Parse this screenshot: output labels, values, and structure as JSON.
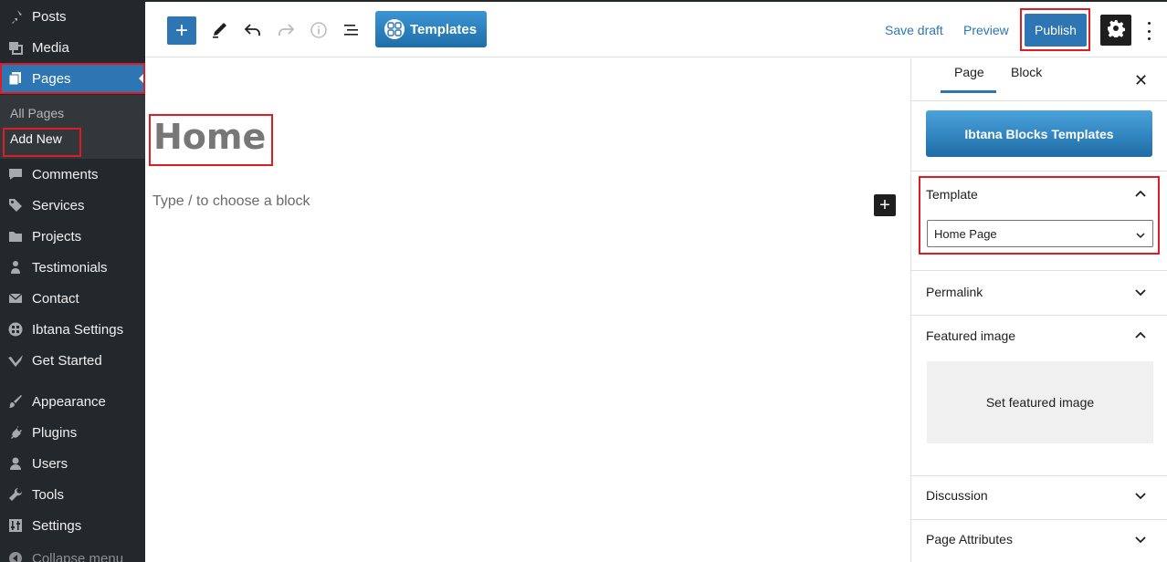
{
  "sidebar": {
    "items": [
      {
        "label": "Posts",
        "icon": "pin-icon"
      },
      {
        "label": "Media",
        "icon": "media-icon"
      },
      {
        "label": "Pages",
        "icon": "pages-icon"
      },
      {
        "label": "Comments",
        "icon": "comment-icon"
      },
      {
        "label": "Services",
        "icon": "tag-icon"
      },
      {
        "label": "Projects",
        "icon": "folder-icon"
      },
      {
        "label": "Testimonials",
        "icon": "users-icon"
      },
      {
        "label": "Contact",
        "icon": "mail-icon"
      },
      {
        "label": "Ibtana Settings",
        "icon": "grid-icon"
      },
      {
        "label": "Get Started",
        "icon": "check-icon"
      },
      {
        "label": "Appearance",
        "icon": "brush-icon"
      },
      {
        "label": "Plugins",
        "icon": "plug-icon"
      },
      {
        "label": "Users",
        "icon": "user-icon"
      },
      {
        "label": "Tools",
        "icon": "wrench-icon"
      },
      {
        "label": "Settings",
        "icon": "sliders-icon"
      },
      {
        "label": "Collapse menu",
        "icon": "collapse-icon"
      }
    ],
    "submenu": {
      "all_pages": "All Pages",
      "add_new": "Add New"
    }
  },
  "toolbar": {
    "templates_label": "Templates",
    "save_draft_label": "Save draft",
    "preview_label": "Preview",
    "publish_label": "Publish"
  },
  "editor": {
    "title": "Home",
    "block_placeholder": "Type / to choose a block"
  },
  "panel": {
    "tabs": [
      "Page",
      "Block"
    ],
    "ibtana_button": "Ibtana Blocks Templates",
    "template_section": "Template",
    "template_value": "Home Page",
    "permalink_section": "Permalink",
    "featured_section": "Featured image",
    "featured_button": "Set featured image",
    "discussion_section": "Discussion",
    "attributes_section": "Page Attributes"
  },
  "colors": {
    "accent": "#2e75b4",
    "sidebar_bg": "#23282d",
    "highlight": "#e01b24"
  }
}
